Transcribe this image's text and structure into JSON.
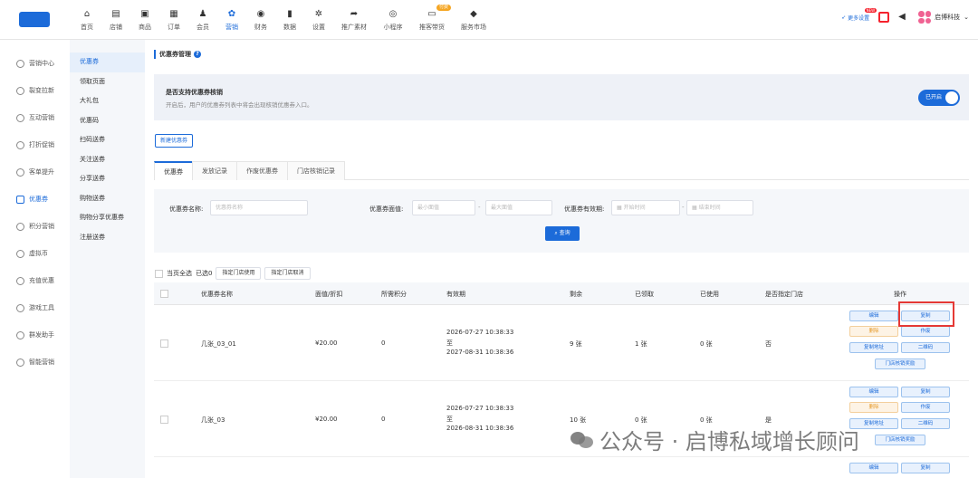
{
  "top_nav": {
    "items": [
      {
        "label": "首页",
        "icon": "home-icon",
        "glyph": "⌂"
      },
      {
        "label": "店铺",
        "icon": "store-icon",
        "glyph": "▤"
      },
      {
        "label": "商品",
        "icon": "goods-icon",
        "glyph": "▣"
      },
      {
        "label": "订单",
        "icon": "order-icon",
        "glyph": "▦"
      },
      {
        "label": "会员",
        "icon": "member-icon",
        "glyph": "♟"
      },
      {
        "label": "营销",
        "icon": "marketing-icon",
        "glyph": "✿"
      },
      {
        "label": "财务",
        "icon": "finance-icon",
        "glyph": "◉"
      },
      {
        "label": "数据",
        "icon": "data-icon",
        "glyph": "▮"
      },
      {
        "label": "设置",
        "icon": "settings-icon",
        "glyph": "✲"
      },
      {
        "label": "推广素材",
        "icon": "share-icon",
        "glyph": "➦"
      },
      {
        "label": "小程序",
        "icon": "miniprogram-icon",
        "glyph": "◎"
      },
      {
        "label": "推客带货",
        "icon": "promoter-icon",
        "glyph": "▭",
        "badge": "付费"
      },
      {
        "label": "服务市场",
        "icon": "market-icon",
        "glyph": "◆"
      }
    ],
    "active_index": 5,
    "more_settings": "更多设置",
    "more_badge": "NEW",
    "company": "启博科技"
  },
  "sidebar_primary": {
    "items": [
      "营销中心",
      "裂变拉新",
      "互动营销",
      "打折促销",
      "客单提升",
      "优惠券",
      "积分营销",
      "虚拟币",
      "充值优惠",
      "游戏工具",
      "群发助手",
      "智能营销"
    ],
    "active_index": 5
  },
  "sidebar_secondary": {
    "items": [
      "优惠券",
      "领取页面",
      "大礼包",
      "优惠码",
      "扫码送券",
      "关注送券",
      "分享送券",
      "购物送券",
      "购物分享优惠券",
      "注册送券"
    ],
    "active_index": 0
  },
  "page": {
    "title": "优惠券管理",
    "notice_title": "是否支持优惠券核销",
    "notice_desc": "开启后，用户的优惠券列表中将会出现核销优惠券入口。",
    "toggle_label": "已开启",
    "new_button": "新建优惠券"
  },
  "tabs": [
    "优惠券",
    "发放记录",
    "作废优惠券",
    "门店核销记录"
  ],
  "filter": {
    "name_label": "优惠券名称:",
    "name_placeholder": "优惠券名称",
    "value_label": "优惠券面值:",
    "min_placeholder": "最小面值",
    "max_placeholder": "最大面值",
    "valid_label": "优惠券有效期:",
    "start_placeholder": "开始时间",
    "end_placeholder": "结束时间",
    "query_button": "查询"
  },
  "bulk": {
    "select_all": "当页全选",
    "selected": "已选0",
    "btn_assign": "指定门店使用",
    "btn_cancel": "指定门店取消"
  },
  "table": {
    "headers": [
      "优惠券名称",
      "面值/折扣",
      "所需积分",
      "有效期",
      "剩余",
      "已领取",
      "已使用",
      "是否指定门店",
      "操作"
    ],
    "rows": [
      {
        "name": "几张_03_01",
        "value": "¥20.00",
        "points": "0",
        "valid_start": "2026-07-27 10:38:33",
        "valid_to": "至",
        "valid_end": "2027-08-31 10:38:36",
        "remaining": "9 张",
        "received": "1 张",
        "used": "0 张",
        "store": "否"
      },
      {
        "name": "几张_03",
        "value": "¥20.00",
        "points": "0",
        "valid_start": "2026-07-27 10:38:33",
        "valid_to": "至",
        "valid_end": "2026-08-31 10:38:36",
        "remaining": "10 张",
        "received": "0 张",
        "used": "0 张",
        "store": "是"
      }
    ],
    "ops": {
      "edit": "编辑",
      "copy": "复制",
      "delete": "删除",
      "void": "作废",
      "copy_link": "复制地址",
      "qrcode": "二维码",
      "store_reward": "门店核销奖励"
    }
  },
  "watermark": "公众号 · 启博私域增长顾问"
}
